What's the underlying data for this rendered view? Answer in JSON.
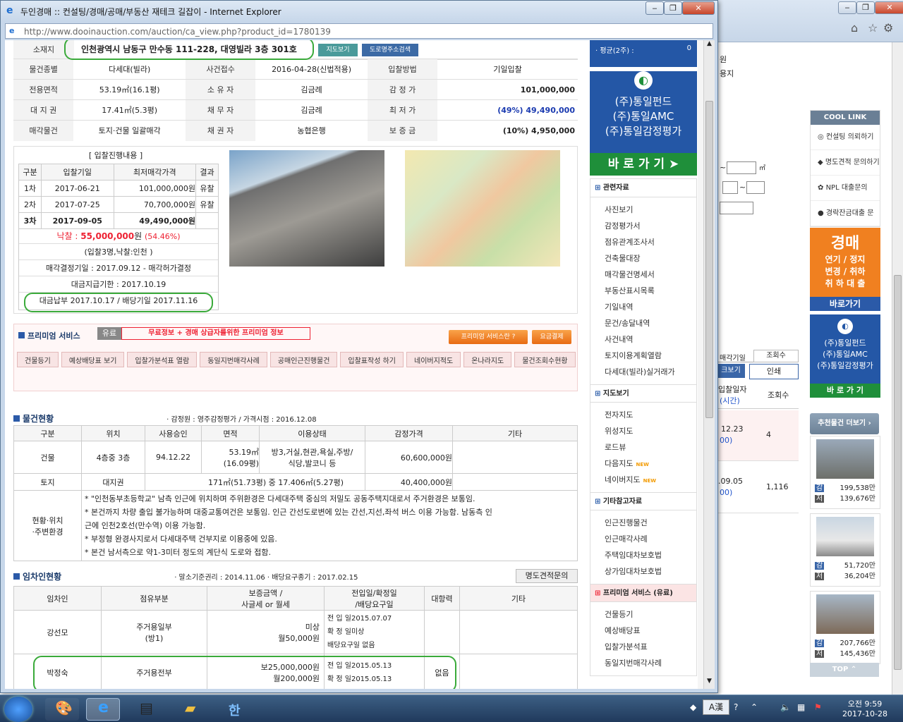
{
  "window": {
    "title": "두인경매 :: 컨설팅/경매/공매/부동산 재테크 길잡이 - Internet Explorer",
    "url": "http://www.dooinauction.com/auction/ca_view.php?product_id=1780139"
  },
  "property": {
    "address_label": "소재지",
    "address": "인천광역시 남동구 만수동 111-228, 대영빌라 3층 301호",
    "map_btn": "지도보기",
    "road_btn": "도로명주소검색",
    "rows": [
      [
        "물건종별",
        "다세대(빌라)",
        "사건접수",
        "2016-04-28(신법적용)",
        "입찰방법",
        "기일입찰"
      ],
      [
        "전용면적",
        "53.19㎡(16.1평)",
        "소 유 자",
        "김금례",
        "감 정 가",
        "101,000,000"
      ],
      [
        "대 지 권",
        "17.41㎡(5.3평)",
        "채 무 자",
        "김금례",
        "최 저 가",
        "(49%) 49,490,000"
      ],
      [
        "매각물건",
        "토지·건물 일괄매각",
        "채 권 자",
        "농협은행",
        "보 증 금",
        "(10%) 4,950,000"
      ]
    ]
  },
  "bidding": {
    "title": "[ 입찰진행내용 ]",
    "headers": [
      "구분",
      "입찰기일",
      "최저매각가격",
      "결과"
    ],
    "rows": [
      [
        "1차",
        "2017-06-21",
        "101,000,000원",
        "유찰"
      ],
      [
        "2차",
        "2017-07-25",
        "70,700,000원",
        "유찰"
      ],
      [
        "3차",
        "2017-09-05",
        "49,490,000원",
        ""
      ]
    ],
    "sold_label": "낙찰 :",
    "sold_price": "55,000,000",
    "sold_unit": "원",
    "sold_pct": "(54.46%)",
    "bidders": "(입찰3명,낙찰:인천 )",
    "decision": "매각결정기일 : 2017.09.12 - 매각허가결정",
    "payment_due": "대금지급기한 : 2017.10.19",
    "payment_done": "대금납부 2017.10.17 / 배당기일 2017.11.16"
  },
  "premium": {
    "title": "프리미엄 서비스",
    "paid": "유료",
    "desc": "무료정보 + 경매 상급자를위한 프리미엄 정보",
    "what_btn": "프리미엄 서비스란 ?",
    "pay_btn": "요금결제",
    "buttons": [
      "건물등기",
      "예상배당표 보기",
      "입찰가분석표 열람",
      "동일지번매각사례",
      "공매인근진행물건",
      "입찰표작성 하기",
      "네이버지적도",
      "온나라지도",
      "물건조회수현황"
    ]
  },
  "status": {
    "title": "물건현황",
    "meta": "· 감정원 : 영주감정평가 / 가격시점 : 2016.12.08",
    "headers": [
      "구분",
      "위치",
      "사용승인",
      "면적",
      "이용상태",
      "감정가격",
      "기타"
    ],
    "building": [
      "건물",
      "4층중 3층",
      "94.12.22",
      "53.19㎡",
      "(16.09평)",
      "방3,거실,현관,욕실,주방/",
      "식당,발코니 등",
      "60,600,000원"
    ],
    "land": [
      "토지",
      "대지권",
      "171㎡(51.73평) 중 17.406㎡(5.27평)",
      "40,400,000원"
    ],
    "env_label1": "현황·위치",
    "env_label2": "·주변환경",
    "env": [
      "* \"인천동부초등학교\" 남측 인근에 위치하며 주위환경은 다세대주택 중심의 저밀도 공동주택지대로서 주거환경은 보통임.",
      "* 본건까지 차량 출입 불가능하며 대중교통여건은 보통임. 인근 간선도로변에 있는 간선,지선,좌석 버스 이용 가능함. 남동측 인",
      "근에 인천2호선(만수역) 이용 가능함.",
      "* 부정형 완경사지로서 다세대주택 건부지로 이용중에 있음.",
      "* 본건 남서측으로 약1-3미터 정도의 계단식 도로와 접함."
    ]
  },
  "tenants": {
    "title": "임차인현황",
    "meta": "· 말소기준권리 : 2014.11.06 · 배당요구종기 : 2017.02.15",
    "btn": "명도견적문의",
    "headers": [
      "임차인",
      "점유부분",
      "보증금액 /",
      "사글세 or 월세",
      "전입일/확정일",
      "/배당요구일",
      "대항력",
      "기타"
    ],
    "rows": [
      {
        "name": "강선모",
        "part1": "주거용일부",
        "part2": "(방1)",
        "dep1": "미상",
        "dep2": "월50,000원",
        "d1": "전 입 일2015.07.07",
        "d2": "확 정 일미상",
        "d3": "배당요구일 없음",
        "opp": ""
      },
      {
        "name": "박정숙",
        "part1": "주거용전부",
        "part2": "",
        "dep1": "보25,000,000원",
        "dep2": "월200,000원",
        "d1": "전 입 일2015.05.13",
        "d2": "확 정 일2015.05.13",
        "d3": "",
        "opp": "없음"
      }
    ]
  },
  "sidebar": {
    "stats": [
      "· 평균(2주) :",
      "0"
    ],
    "ad": {
      "l1": "(주)통일펀드",
      "l2": "(주)통일AMC",
      "l3": "(주)통일감정평가",
      "go": "바 로 가 기"
    },
    "related_title": "관련자료",
    "related": [
      "사진보기",
      "감정평가서",
      "점유관계조사서",
      "건축물대장",
      "매각물건명세서",
      "부동산표시목록",
      "기일내역",
      "문건/송달내역",
      "사건내역",
      "토지이용계획열람",
      "다세대(빌라)실거래가"
    ],
    "map_title": "지도보기",
    "maps": [
      "전자지도",
      "위성지도",
      "로드뷰",
      "다음지도",
      "네이버지도"
    ],
    "new": "NEW",
    "etc_title": "기타참고자료",
    "etc": [
      "인근진행물건",
      "인근매각사례",
      "주택임대차보호법",
      "상가임대차보호법"
    ],
    "prem_title": "프리미엄 서비스 (유료)",
    "prem": [
      "건물등기",
      "예상배당표",
      "입찰가분석표",
      "동일지번매각사례"
    ]
  },
  "background": {
    "cool_title": "COOL LINK",
    "cool": [
      "컨설팅 의뢰하기",
      "명도견적 문의하기",
      "NPL 대출문의",
      "경락잔금대출 문의"
    ],
    "orange": {
      "t": "경매",
      "l1": "연기 / 정지",
      "l2": "변경 / 취하",
      "l3": "취 하 대 출",
      "go": "바로가기"
    },
    "ad2": {
      "l1": "(주)통일펀드",
      "l2": "(주)통일AMC",
      "l3": "(주)통일감정평가",
      "go": "바 로 가 기"
    },
    "recommend": "추천물건 더보기 ›",
    "items": [
      {
        "a": "199,538만",
        "b": "139,676만"
      },
      {
        "a": "51,720만",
        "b": "36,204만"
      },
      {
        "a": "207,766만",
        "b": "145,436만"
      }
    ],
    "gam": "감",
    "jeo": "저",
    "top": "TOP ⌃",
    "frag": {
      "a": "원",
      "b": "용지",
      "m2": "㎡",
      "tilde": "~",
      "sale": "매각기일",
      "views": "조회수",
      "view": "크보기",
      "print": "인쇄",
      "bid": "입찰일자",
      "time": "(시간)",
      "vcol": "조회수",
      "d1": "12.23",
      "d1b": "00)",
      "v1": "4",
      "d2": ".09.05",
      "d2b": "00)",
      "v2": "1,116"
    }
  },
  "taskbar": {
    "time": "오전 9:59",
    "date": "2017-10-28",
    "ime": "A漢"
  }
}
